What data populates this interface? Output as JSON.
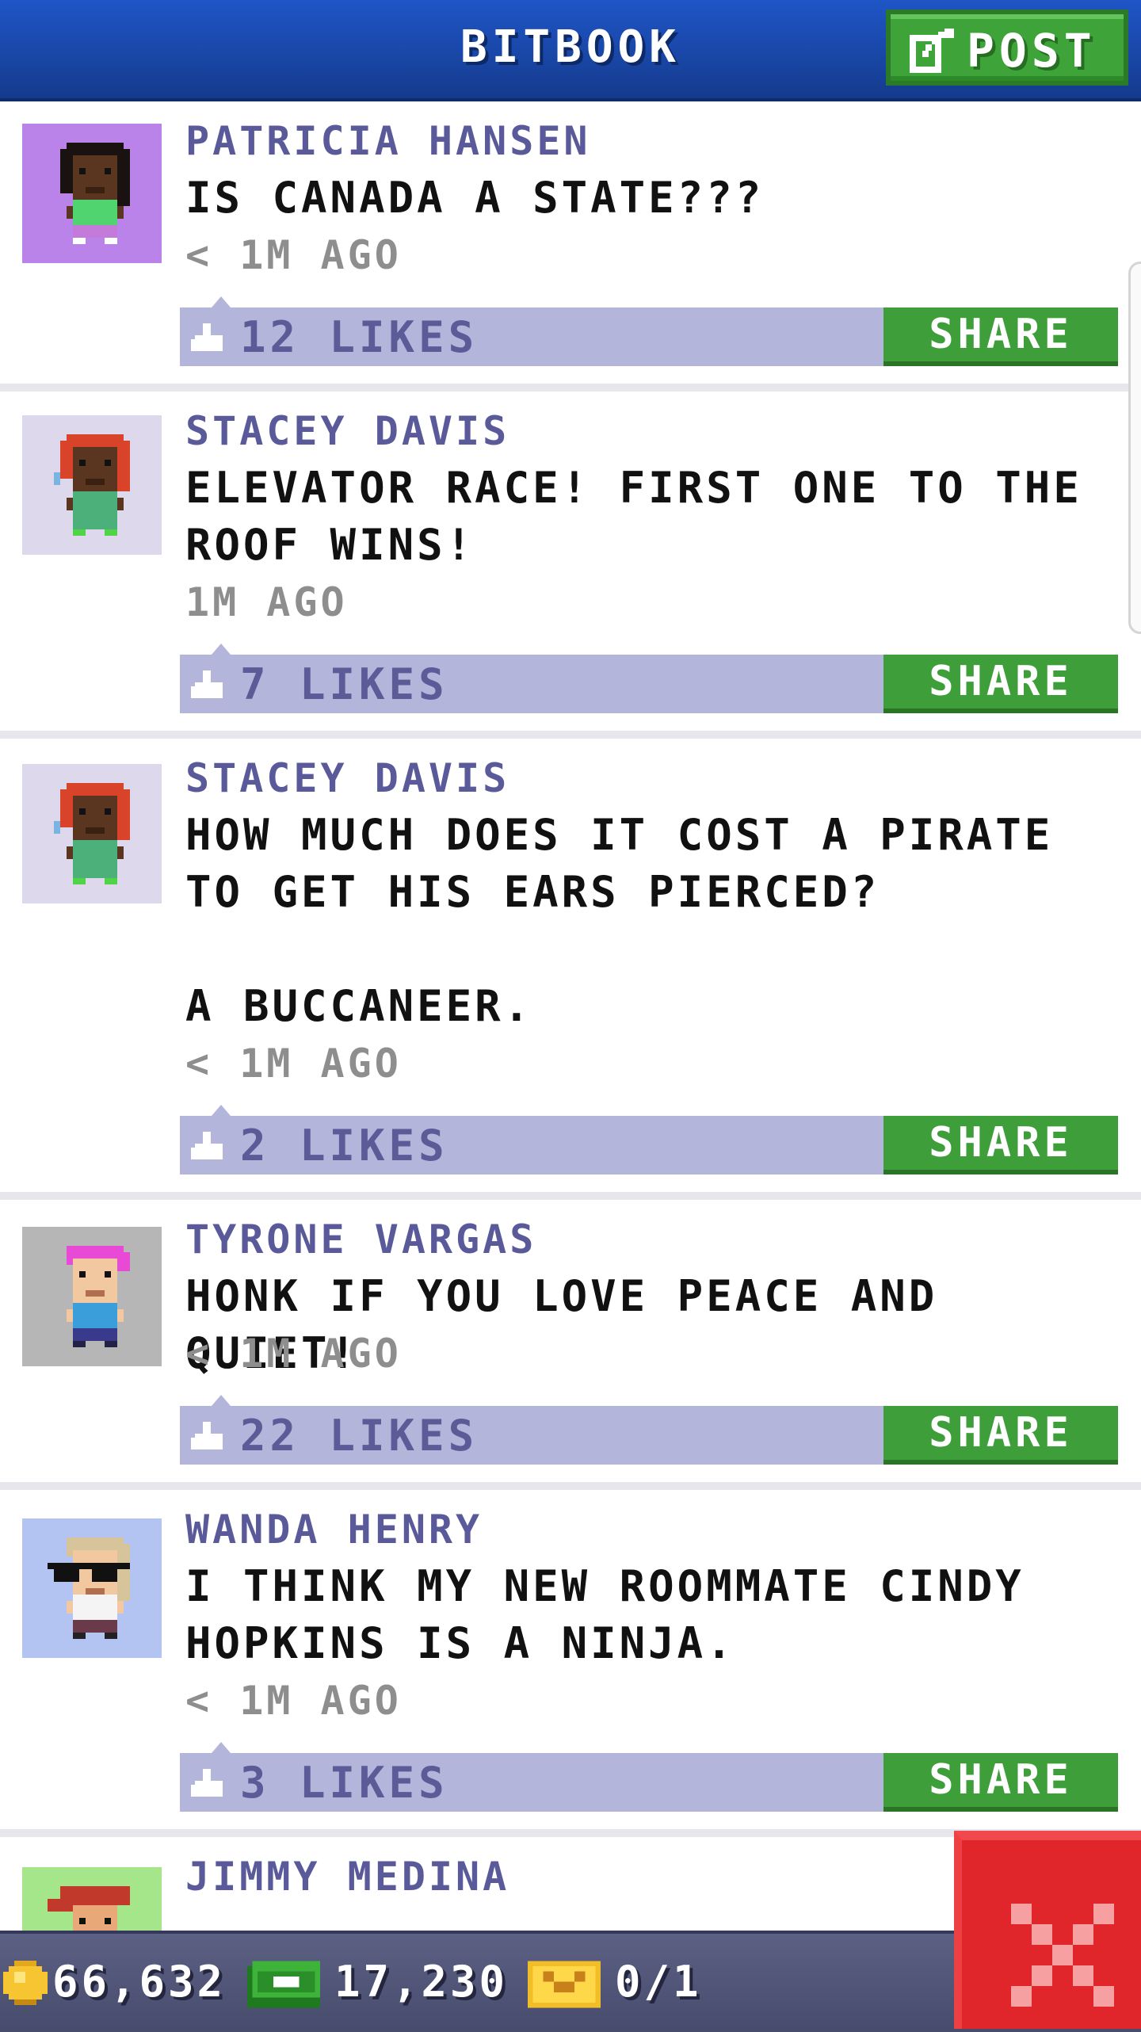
{
  "header": {
    "title": "BITBOOK",
    "post_label": "POST"
  },
  "posts": [
    {
      "author": "PATRICIA HANSEN",
      "text": "IS CANADA A STATE???",
      "time": "< 1M AGO",
      "likes": "12 LIKES",
      "share_label": "SHARE",
      "avatar": {
        "bg": "#b983ea",
        "skin": "#5a3520",
        "hair": "#1a1210",
        "shirt": "#4fd470",
        "pants": "#c47ad8",
        "shoes": "#ffffff",
        "accessory": "none"
      }
    },
    {
      "author": "STACEY DAVIS",
      "text": "ELEVATOR RACE! FIRST ONE TO THE ROOF WINS!",
      "time": "1M AGO",
      "likes": "7 LIKES",
      "share_label": "SHARE",
      "avatar": {
        "bg": "#ddd8ec",
        "skin": "#5a3520",
        "hair": "#d9432a",
        "shirt": "#4cb07a",
        "pants": "#4cb07a",
        "shoes": "#4fd447",
        "accessory": "none"
      }
    },
    {
      "author": "STACEY DAVIS",
      "text": "HOW MUCH DOES IT COST A PIRATE TO GET HIS EARS PIERCED?\n\nA BUCCANEER.",
      "time": "< 1M AGO",
      "likes": "2 LIKES",
      "share_label": "SHARE",
      "avatar": {
        "bg": "#ddd8ec",
        "skin": "#5a3520",
        "hair": "#d9432a",
        "shirt": "#4cb07a",
        "pants": "#4cb07a",
        "shoes": "#4fd447",
        "accessory": "none"
      }
    },
    {
      "author": "TYRONE VARGAS",
      "text": "HONK IF YOU LOVE PEACE AND QUIET!",
      "time": "< 1M AGO",
      "likes": "22 LIKES",
      "share_label": "SHARE",
      "avatar": {
        "bg": "#b6b6b6",
        "skin": "#f2c8a0",
        "hair": "#e84ad6",
        "shirt": "#3a9edb",
        "pants": "#3a3a8c",
        "shoes": "#222244",
        "accessory": "none"
      }
    },
    {
      "author": "WANDA HENRY",
      "text": "I THINK MY NEW ROOMMATE CINDY HOPKINS IS A NINJA.",
      "time": "< 1M AGO",
      "likes": "3 LIKES",
      "share_label": "SHARE",
      "avatar": {
        "bg": "#b3c4f2",
        "skin": "#f2c8a0",
        "hair": "#d8c49a",
        "shirt": "#f4f4f4",
        "pants": "#6a3a4a",
        "shoes": "#222222",
        "accessory": "sunglasses"
      }
    },
    {
      "author": "JIMMY MEDINA",
      "text": "",
      "time": "",
      "likes": "",
      "share_label": "",
      "avatar": {
        "bg": "#a6e68a",
        "skin": "#e8a878",
        "hair": "#c0392b",
        "shirt": "#c0392b",
        "pants": "#c0392b",
        "shoes": "#c0392b",
        "accessory": "cap"
      }
    }
  ],
  "bottom_bar": {
    "coins": "66,632",
    "bux": "17,230",
    "tickets": "0/1",
    "coin_icon": "coin-icon",
    "bux_icon": "cash-icon",
    "ticket_icon": "ticket-icon"
  },
  "close_icon": "close-icon"
}
